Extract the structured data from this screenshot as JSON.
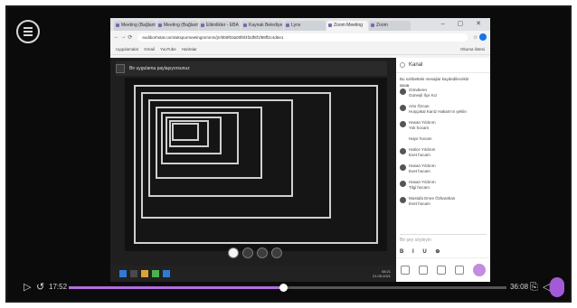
{
  "browser": {
    "tabs": [
      "Meeting (Bağlantı)",
      "Meeting (Bağlantı)",
      "Etkinlikler - EBA",
      "Kaynak Belediye",
      "Lynx",
      "Zoom Meeting",
      "Zoom"
    ],
    "window_controls": "– ▢ ✕",
    "url": "eudiborhstat.com/wkspurmeetingmmmm/jrr/9b9f03a00f5f4f2df8f1f98ff2c4d6e1",
    "bookmarks": [
      "Uygulamalar",
      "Gmail",
      "YouTube",
      "Haritalar"
    ],
    "reading_list": "Okuma listesi"
  },
  "meeting": {
    "share_label": "Bir uygulama paylaşıyorsunuz",
    "chat_title": "Kanal",
    "chat_note": "Bu sohbetteki mesajlar kaydedilecektir",
    "messages": [
      {
        "sender": "Gönderen",
        "text": "Güneşli İlçe Kız",
        "time": ""
      },
      {
        "sender": "Arto Özcan",
        "text": "Hoşçakal Kaniz Hakam'ın şeklin",
        "time": "08:01"
      },
      {
        "sender": "Hasan Yıldırım",
        "text": "Yok hocam",
        "time": "08:02"
      },
      {
        "sender": "",
        "text": "Hayır hocam",
        "time": ""
      },
      {
        "sender": "Hatice Yıldırım",
        "text": "Evet hocam",
        "time": "08:03"
      },
      {
        "sender": "Hasan Yıldırım",
        "text": "Evet hocam",
        "time": "08:03"
      },
      {
        "sender": "Hasan Yıldırım",
        "text": "Tilgi hocam",
        "time": "08:04"
      },
      {
        "sender": "Mustafa Emre Özkarahan",
        "text": "Evet hocam",
        "time": "08:05"
      }
    ],
    "chat_input_placeholder": "Bir şey söyleyin",
    "format_buttons": "B I U ⊕",
    "tray_time": "08:21",
    "tray_date": "21.05.2021"
  },
  "player": {
    "current_time": "17:52",
    "total_time": "36:08",
    "progress_fraction": 0.49,
    "accent": "#b46ee0"
  }
}
